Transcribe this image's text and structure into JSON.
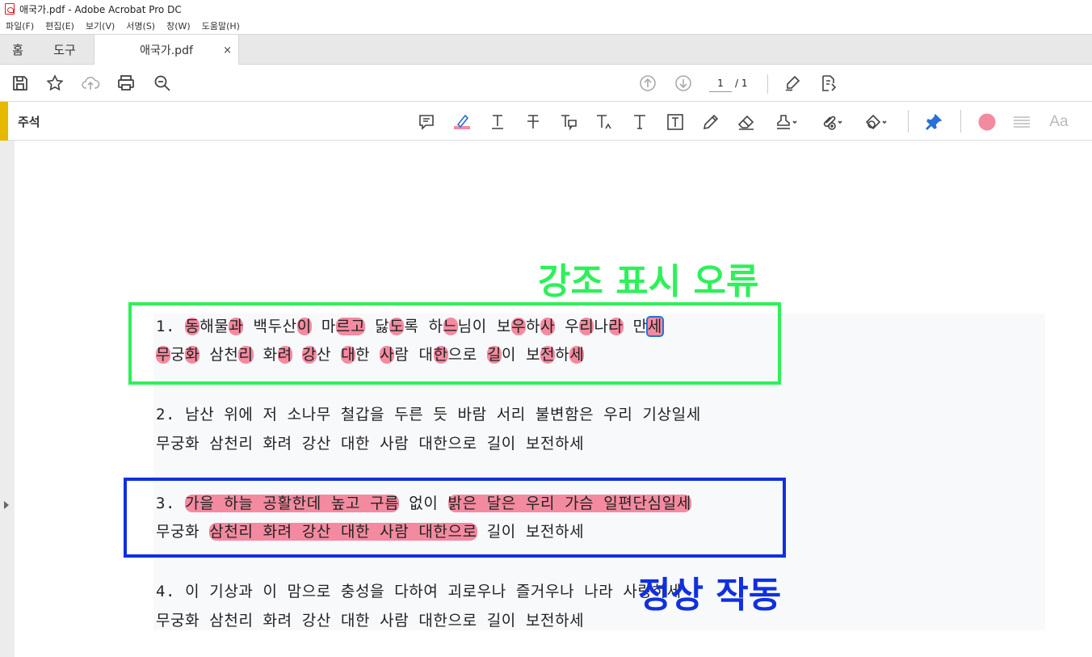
{
  "window": {
    "title": "애국가.pdf - Adobe Acrobat Pro DC"
  },
  "menu": [
    "파일(F)",
    "편집(E)",
    "보기(V)",
    "서명(S)",
    "창(W)",
    "도움말(H)"
  ],
  "tabs": {
    "home": "홈",
    "tools": "도구",
    "document": "애국가.pdf",
    "close": "×"
  },
  "toolbar": {
    "page_current": "1",
    "page_total": "/ 1"
  },
  "comment_toolbar": {
    "label": "주석",
    "color_accent": "#f48aa0"
  },
  "document": {
    "verse1": {
      "line1": [
        {
          "t": "1. "
        },
        {
          "t": "동",
          "h": true
        },
        {
          "t": "해물"
        },
        {
          "t": "과",
          "h": true
        },
        {
          "t": " 백두산"
        },
        {
          "t": "이",
          "h": true
        },
        {
          "t": " 마"
        },
        {
          "t": "르고",
          "h": true
        },
        {
          "t": " 닳"
        },
        {
          "t": "도",
          "h": true
        },
        {
          "t": "록 하"
        },
        {
          "t": "느",
          "h": true
        },
        {
          "t": "님이 보"
        },
        {
          "t": "우",
          "h": true
        },
        {
          "t": "하"
        },
        {
          "t": "사",
          "h": true
        },
        {
          "t": " 우"
        },
        {
          "t": "리",
          "h": true
        },
        {
          "t": "나"
        },
        {
          "t": "라",
          "h": true
        },
        {
          "t": " 만"
        },
        {
          "t": "세",
          "h": true,
          "sel": true
        }
      ],
      "line2": [
        {
          "t": "무",
          "h": true
        },
        {
          "t": "궁"
        },
        {
          "t": "화",
          "h": true
        },
        {
          "t": " 삼천"
        },
        {
          "t": "리",
          "h": true
        },
        {
          "t": " 화"
        },
        {
          "t": "려",
          "h": true
        },
        {
          "t": " "
        },
        {
          "t": "강",
          "h": true
        },
        {
          "t": "산 "
        },
        {
          "t": "대",
          "h": true
        },
        {
          "t": "한 "
        },
        {
          "t": "사",
          "h": true
        },
        {
          "t": "람 대"
        },
        {
          "t": "한",
          "h": true
        },
        {
          "t": "으로 "
        },
        {
          "t": "길",
          "h": true
        },
        {
          "t": "이 보"
        },
        {
          "t": "전",
          "h": true
        },
        {
          "t": "하"
        },
        {
          "t": "세",
          "h": true
        }
      ]
    },
    "verse2": {
      "line1": "2. 남산 위에 저 소나무 철갑을 두른 듯 바람 서리 불변함은 우리 기상일세",
      "line2": "무궁화 삼천리 화려 강산 대한 사람 대한으로 길이 보전하세"
    },
    "verse3": {
      "line1": [
        {
          "t": "3. "
        },
        {
          "t": "가을 하늘 공활한데 높고 구름",
          "h": true
        },
        {
          "t": " 없이 "
        },
        {
          "t": "밝은 달은 우리 가슴 일편단심일세",
          "h": true
        }
      ],
      "line2": [
        {
          "t": "무궁화 "
        },
        {
          "t": "삼천리 화려 강산 대한 사람 대한으로",
          "h": true
        },
        {
          "t": " 길이 보전하세"
        }
      ]
    },
    "verse4": {
      "line1": "4. 이 기상과 이 맘으로 충성을 다하여 괴로우나 즐거우나 나라 사랑하세",
      "line2": "무궁화 삼천리 화려 강산 대한 사람 대한으로 길이 보전하세"
    }
  },
  "annotations": {
    "error_label": "강조 표시 오류",
    "error_color": "#2ef05a",
    "ok_label": "정상 작동",
    "ok_color": "#1030e0"
  }
}
